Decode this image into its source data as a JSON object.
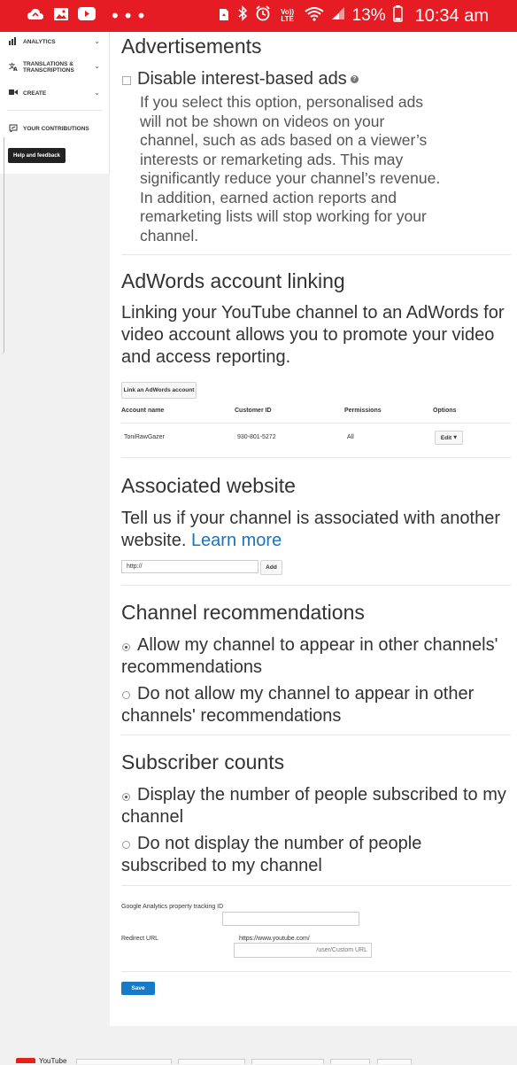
{
  "status_bar": {
    "battery_percent": "13%",
    "time": "10:34 am",
    "volte_label": "Vo)) LTE"
  },
  "sidebar": {
    "items": [
      {
        "label": "ANALYTICS",
        "icon": "bar-chart-icon"
      },
      {
        "label": "TRANSLATIONS & TRANSCRIPTIONS",
        "icon": "translate-icon"
      },
      {
        "label": "CREATE",
        "icon": "video-camera-icon"
      },
      {
        "label": "YOUR CONTRIBUTIONS",
        "icon": "contributions-icon"
      }
    ],
    "help_button": "Help and feedback"
  },
  "advertisements": {
    "title": "Advertisements",
    "checkbox_label": "Disable interest-based ads",
    "checked": false,
    "description": "If you select this option, personalised ads will not be shown on videos on your channel, such as ads based on a viewer’s interests or remarketing ads. This may significantly reduce your channel’s revenue. In addition, earned action reports and remarketing lists will stop working for your channel."
  },
  "adwords": {
    "title": "AdWords account linking",
    "description": "Linking your YouTube channel to an AdWords for video account allows you to promote your video and access reporting.",
    "link_button": "Link an AdWords account",
    "columns": [
      "Account name",
      "Customer ID",
      "Permissions",
      "Options"
    ],
    "rows": [
      {
        "account_name": "ToniRawGazer",
        "customer_id": "930-801-5272",
        "permissions": "All",
        "options": "Edit"
      }
    ]
  },
  "associated_website": {
    "title": "Associated website",
    "description": "Tell us if your channel is associated with another website.",
    "learn_more": "Learn more",
    "input_value": "http://",
    "add_button": "Add"
  },
  "channel_recommendations": {
    "title": "Channel recommendations",
    "options": [
      {
        "label": "Allow my channel to appear in other channels' recommendations",
        "selected": true
      },
      {
        "label": "Do not allow my channel to appear in other channels' recommendations",
        "selected": false
      }
    ]
  },
  "subscriber_counts": {
    "title": "Subscriber counts",
    "options": [
      {
        "label": "Display the number of people subscribed to my channel",
        "selected": true
      },
      {
        "label": "Do not display the number of people subscribed to my channel",
        "selected": false
      }
    ]
  },
  "tracking": {
    "ga_label": "Google Analytics property tracking ID",
    "ga_value": "",
    "redirect_label": "Redirect URL",
    "redirect_prefix": "https://www.youtube.com/",
    "redirect_placeholder": "/user/Custom URL"
  },
  "save_button": "Save",
  "footer": {
    "logo_text": "YouTube"
  },
  "colors": {
    "status_bar": "#e51c23",
    "link": "#1a73c2",
    "save_button": "#167ac6"
  }
}
